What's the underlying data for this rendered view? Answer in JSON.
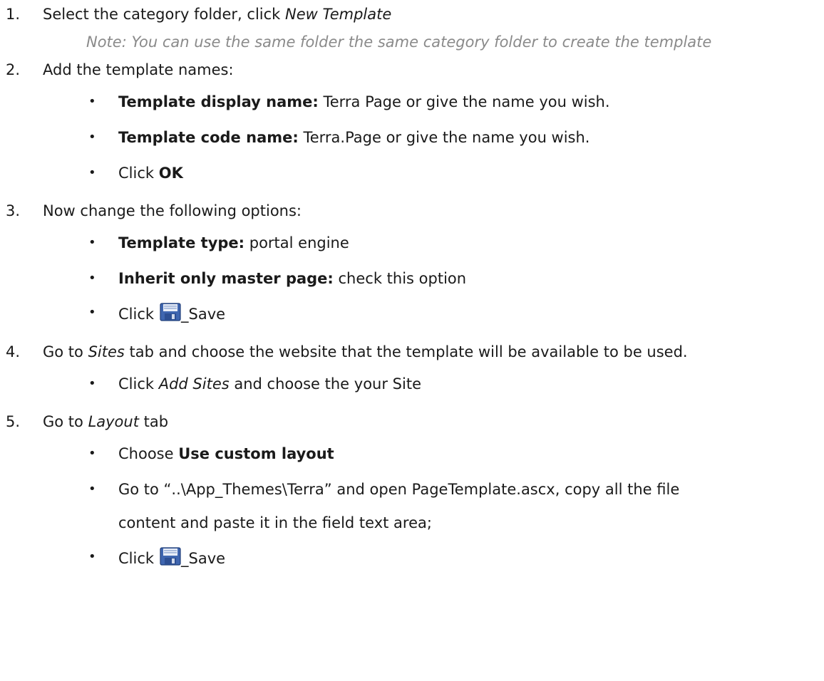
{
  "steps": [
    {
      "number": "1.",
      "text_before": "Select the category folder, click ",
      "text_italic": "New Template",
      "note": "Note: You can use the same folder the same category folder to create the template"
    },
    {
      "number": "2.",
      "text": "Add the template names:",
      "bullets": [
        {
          "label": "Template display name:",
          "text": " Terra Page or give the name you wish."
        },
        {
          "label": "Template code name:",
          "text": " Terra.Page or give the name you wish."
        },
        {
          "prefix": "Click ",
          "label": "OK"
        }
      ]
    },
    {
      "number": "3.",
      "text": "Now change the following options:",
      "bullets": [
        {
          "label": "Template type:",
          "text": " portal engine"
        },
        {
          "label": "Inherit only master page:",
          "text": " check this option"
        },
        {
          "prefix": "Click",
          "suffix": "_Save",
          "icon": "save-icon"
        }
      ]
    },
    {
      "number": "4.",
      "text_before": "Go to ",
      "text_italic": "Sites",
      "text_after": " tab and choose the website that the template will be available to be used.",
      "bullets": [
        {
          "prefix": "Click ",
          "italic": "Add Sites",
          "text": " and choose the your Site"
        }
      ]
    },
    {
      "number": "5.",
      "text_before": "Go to ",
      "text_italic": "Layout",
      "text_after": " tab",
      "bullets": [
        {
          "prefix": "Choose ",
          "label": "Use custom layout"
        },
        {
          "line1": "Go to “..\\App_Themes\\Terra” and open PageTemplate.ascx, copy all the file",
          "line2": "content and paste it in the field text area;"
        },
        {
          "prefix": "Click",
          "suffix": "_Save",
          "icon": "save-icon"
        }
      ]
    }
  ],
  "bullet_char": "•"
}
